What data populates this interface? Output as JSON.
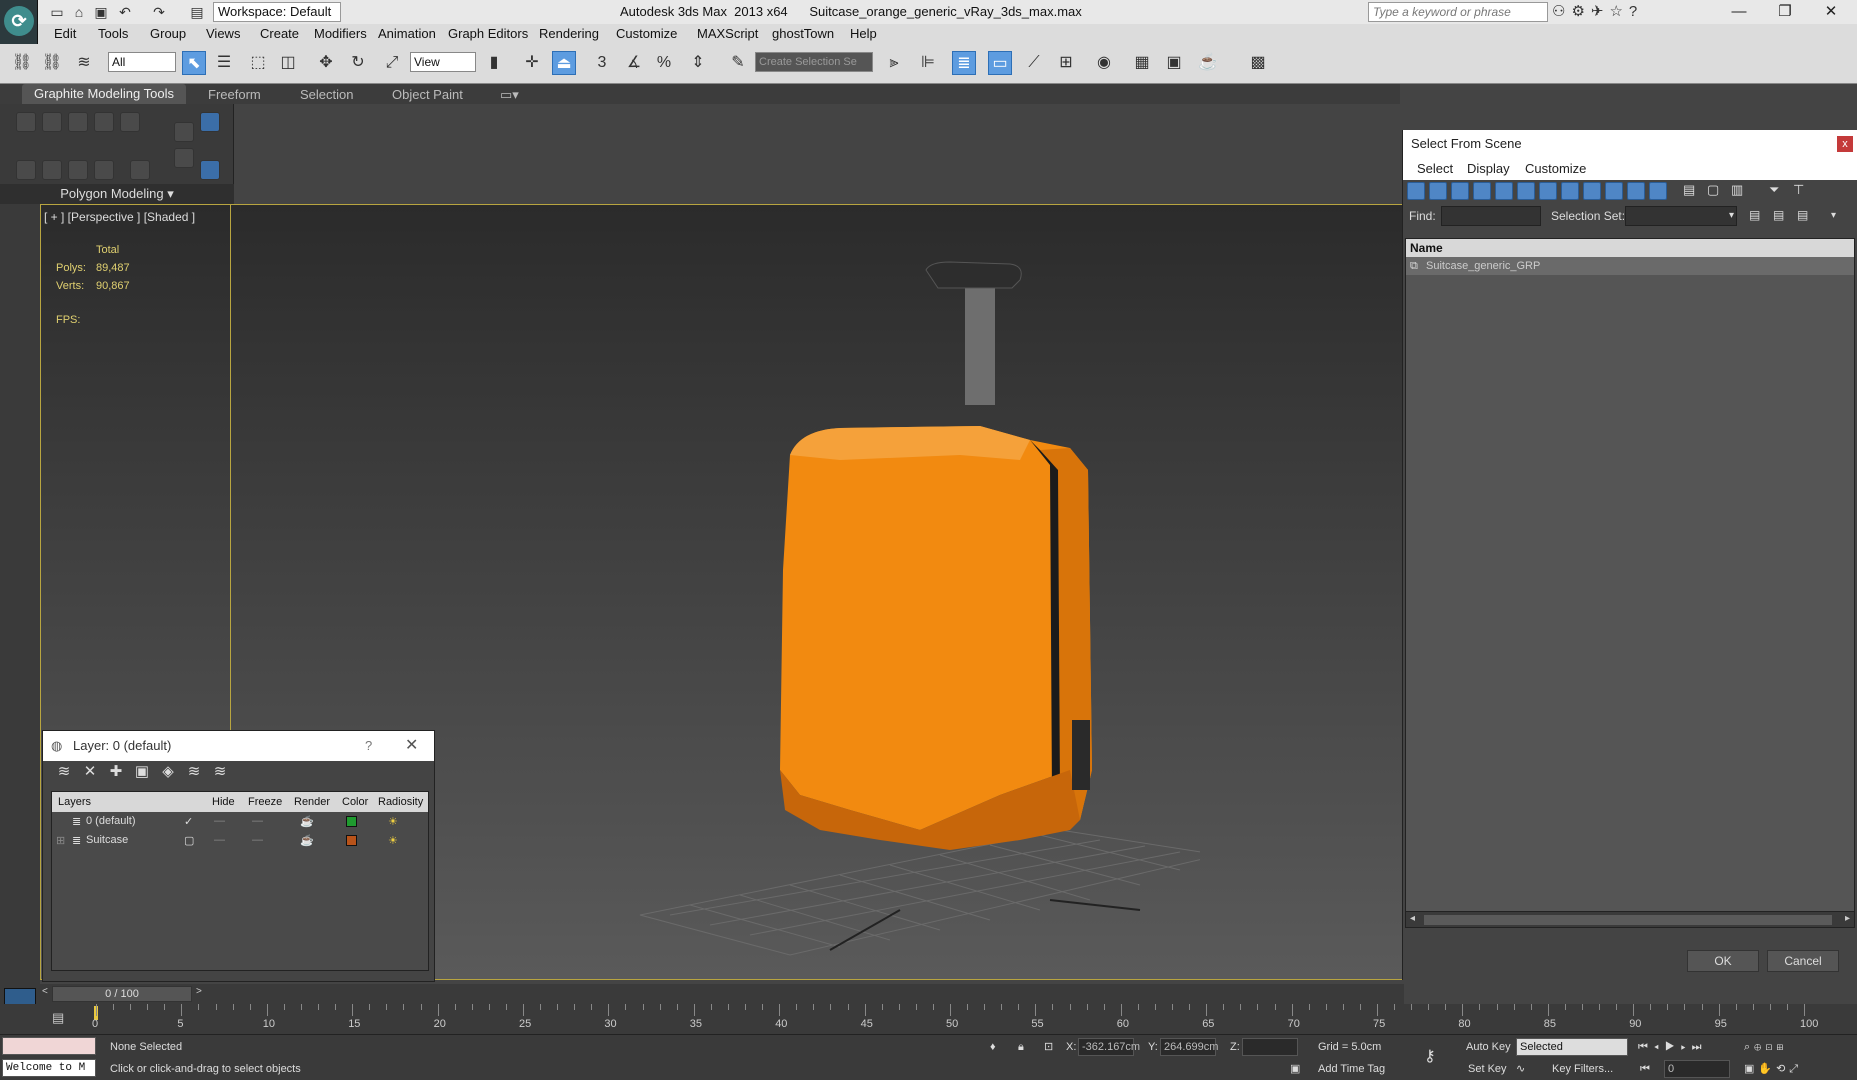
{
  "titlebar": {
    "workspace": "Workspace: Default",
    "app_title": "Autodesk 3ds Max  2013 x64      Suitcase_orange_generic_vRay_3ds_max.max",
    "search_placeholder": "Type a keyword or phrase"
  },
  "menu": [
    "Edit",
    "Tools",
    "Group",
    "Views",
    "Create",
    "Modifiers",
    "Animation",
    "Graph Editors",
    "Rendering",
    "Customize",
    "MAXScript",
    "ghostTown",
    "Help"
  ],
  "toolbar": {
    "filter_value": "All",
    "coord_value": "View",
    "selection_set_placeholder": "Create Selection Se"
  },
  "ribbon": {
    "tabs": [
      "Graphite Modeling Tools",
      "Freeform",
      "Selection",
      "Object Paint"
    ],
    "panel_label": "Polygon Modeling"
  },
  "viewport": {
    "label": "[ + ] [Perspective ] [Shaded ]",
    "stats_total": "Total",
    "polys_label": "Polys:",
    "polys_value": "89,487",
    "verts_label": "Verts:",
    "verts_value": "90,867",
    "fps_label": "FPS:"
  },
  "layer_dialog": {
    "title": "Layer: 0 (default)",
    "help": "?",
    "columns": [
      "Layers",
      "Hide",
      "Freeze",
      "Render",
      "Color",
      "Radiosity"
    ],
    "rows": [
      {
        "name": "0 (default)",
        "color": "#1f9a2f"
      },
      {
        "name": "Suitcase",
        "color": "#b8531a"
      }
    ]
  },
  "select_dialog": {
    "title": "Select From Scene",
    "menu": [
      "Select",
      "Display",
      "Customize"
    ],
    "find_label": "Find:",
    "selset_label": "Selection Set:",
    "column_name": "Name",
    "items": [
      "Suitcase_generic_GRP"
    ],
    "ok": "OK",
    "cancel": "Cancel"
  },
  "timeline": {
    "frame": "0 / 100",
    "ticks": [
      "0",
      "5",
      "10",
      "15",
      "20",
      "25",
      "30",
      "35",
      "40",
      "45",
      "50",
      "55",
      "60",
      "65",
      "70",
      "75",
      "80",
      "85",
      "90",
      "95",
      "100"
    ]
  },
  "status": {
    "script_listener": "Welcome to M",
    "selection": "None Selected",
    "prompt": "Click or click-and-drag to select objects",
    "x_label": "X:",
    "x_value": "-362.167cm",
    "y_label": "Y:",
    "y_value": "264.699cm",
    "z_label": "Z:",
    "z_value": "",
    "grid": "Grid = 5.0cm",
    "add_time_tag": "Add Time Tag",
    "auto_key": "Auto Key",
    "set_key": "Set Key",
    "selected": "Selected",
    "key_filters": "Key Filters...",
    "frame_value": "0"
  },
  "colors": {
    "accent": "#5d9ce0",
    "suitcase": "#f28a10",
    "viewport_border": "#b8a540"
  }
}
